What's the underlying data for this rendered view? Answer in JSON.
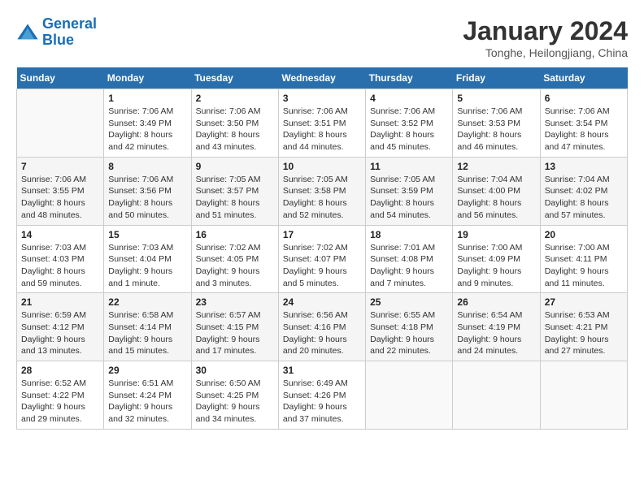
{
  "header": {
    "logo_general": "General",
    "logo_blue": "Blue",
    "month_title": "January 2024",
    "subtitle": "Tonghe, Heilongjiang, China"
  },
  "days_of_week": [
    "Sunday",
    "Monday",
    "Tuesday",
    "Wednesday",
    "Thursday",
    "Friday",
    "Saturday"
  ],
  "weeks": [
    [
      {
        "day": "",
        "sunrise": "",
        "sunset": "",
        "daylight": ""
      },
      {
        "day": "1",
        "sunrise": "Sunrise: 7:06 AM",
        "sunset": "Sunset: 3:49 PM",
        "daylight": "Daylight: 8 hours and 42 minutes."
      },
      {
        "day": "2",
        "sunrise": "Sunrise: 7:06 AM",
        "sunset": "Sunset: 3:50 PM",
        "daylight": "Daylight: 8 hours and 43 minutes."
      },
      {
        "day": "3",
        "sunrise": "Sunrise: 7:06 AM",
        "sunset": "Sunset: 3:51 PM",
        "daylight": "Daylight: 8 hours and 44 minutes."
      },
      {
        "day": "4",
        "sunrise": "Sunrise: 7:06 AM",
        "sunset": "Sunset: 3:52 PM",
        "daylight": "Daylight: 8 hours and 45 minutes."
      },
      {
        "day": "5",
        "sunrise": "Sunrise: 7:06 AM",
        "sunset": "Sunset: 3:53 PM",
        "daylight": "Daylight: 8 hours and 46 minutes."
      },
      {
        "day": "6",
        "sunrise": "Sunrise: 7:06 AM",
        "sunset": "Sunset: 3:54 PM",
        "daylight": "Daylight: 8 hours and 47 minutes."
      }
    ],
    [
      {
        "day": "7",
        "sunrise": "Sunrise: 7:06 AM",
        "sunset": "Sunset: 3:55 PM",
        "daylight": "Daylight: 8 hours and 48 minutes."
      },
      {
        "day": "8",
        "sunrise": "Sunrise: 7:06 AM",
        "sunset": "Sunset: 3:56 PM",
        "daylight": "Daylight: 8 hours and 50 minutes."
      },
      {
        "day": "9",
        "sunrise": "Sunrise: 7:05 AM",
        "sunset": "Sunset: 3:57 PM",
        "daylight": "Daylight: 8 hours and 51 minutes."
      },
      {
        "day": "10",
        "sunrise": "Sunrise: 7:05 AM",
        "sunset": "Sunset: 3:58 PM",
        "daylight": "Daylight: 8 hours and 52 minutes."
      },
      {
        "day": "11",
        "sunrise": "Sunrise: 7:05 AM",
        "sunset": "Sunset: 3:59 PM",
        "daylight": "Daylight: 8 hours and 54 minutes."
      },
      {
        "day": "12",
        "sunrise": "Sunrise: 7:04 AM",
        "sunset": "Sunset: 4:00 PM",
        "daylight": "Daylight: 8 hours and 56 minutes."
      },
      {
        "day": "13",
        "sunrise": "Sunrise: 7:04 AM",
        "sunset": "Sunset: 4:02 PM",
        "daylight": "Daylight: 8 hours and 57 minutes."
      }
    ],
    [
      {
        "day": "14",
        "sunrise": "Sunrise: 7:03 AM",
        "sunset": "Sunset: 4:03 PM",
        "daylight": "Daylight: 8 hours and 59 minutes."
      },
      {
        "day": "15",
        "sunrise": "Sunrise: 7:03 AM",
        "sunset": "Sunset: 4:04 PM",
        "daylight": "Daylight: 9 hours and 1 minute."
      },
      {
        "day": "16",
        "sunrise": "Sunrise: 7:02 AM",
        "sunset": "Sunset: 4:05 PM",
        "daylight": "Daylight: 9 hours and 3 minutes."
      },
      {
        "day": "17",
        "sunrise": "Sunrise: 7:02 AM",
        "sunset": "Sunset: 4:07 PM",
        "daylight": "Daylight: 9 hours and 5 minutes."
      },
      {
        "day": "18",
        "sunrise": "Sunrise: 7:01 AM",
        "sunset": "Sunset: 4:08 PM",
        "daylight": "Daylight: 9 hours and 7 minutes."
      },
      {
        "day": "19",
        "sunrise": "Sunrise: 7:00 AM",
        "sunset": "Sunset: 4:09 PM",
        "daylight": "Daylight: 9 hours and 9 minutes."
      },
      {
        "day": "20",
        "sunrise": "Sunrise: 7:00 AM",
        "sunset": "Sunset: 4:11 PM",
        "daylight": "Daylight: 9 hours and 11 minutes."
      }
    ],
    [
      {
        "day": "21",
        "sunrise": "Sunrise: 6:59 AM",
        "sunset": "Sunset: 4:12 PM",
        "daylight": "Daylight: 9 hours and 13 minutes."
      },
      {
        "day": "22",
        "sunrise": "Sunrise: 6:58 AM",
        "sunset": "Sunset: 4:14 PM",
        "daylight": "Daylight: 9 hours and 15 minutes."
      },
      {
        "day": "23",
        "sunrise": "Sunrise: 6:57 AM",
        "sunset": "Sunset: 4:15 PM",
        "daylight": "Daylight: 9 hours and 17 minutes."
      },
      {
        "day": "24",
        "sunrise": "Sunrise: 6:56 AM",
        "sunset": "Sunset: 4:16 PM",
        "daylight": "Daylight: 9 hours and 20 minutes."
      },
      {
        "day": "25",
        "sunrise": "Sunrise: 6:55 AM",
        "sunset": "Sunset: 4:18 PM",
        "daylight": "Daylight: 9 hours and 22 minutes."
      },
      {
        "day": "26",
        "sunrise": "Sunrise: 6:54 AM",
        "sunset": "Sunset: 4:19 PM",
        "daylight": "Daylight: 9 hours and 24 minutes."
      },
      {
        "day": "27",
        "sunrise": "Sunrise: 6:53 AM",
        "sunset": "Sunset: 4:21 PM",
        "daylight": "Daylight: 9 hours and 27 minutes."
      }
    ],
    [
      {
        "day": "28",
        "sunrise": "Sunrise: 6:52 AM",
        "sunset": "Sunset: 4:22 PM",
        "daylight": "Daylight: 9 hours and 29 minutes."
      },
      {
        "day": "29",
        "sunrise": "Sunrise: 6:51 AM",
        "sunset": "Sunset: 4:24 PM",
        "daylight": "Daylight: 9 hours and 32 minutes."
      },
      {
        "day": "30",
        "sunrise": "Sunrise: 6:50 AM",
        "sunset": "Sunset: 4:25 PM",
        "daylight": "Daylight: 9 hours and 34 minutes."
      },
      {
        "day": "31",
        "sunrise": "Sunrise: 6:49 AM",
        "sunset": "Sunset: 4:26 PM",
        "daylight": "Daylight: 9 hours and 37 minutes."
      },
      {
        "day": "",
        "sunrise": "",
        "sunset": "",
        "daylight": ""
      },
      {
        "day": "",
        "sunrise": "",
        "sunset": "",
        "daylight": ""
      },
      {
        "day": "",
        "sunrise": "",
        "sunset": "",
        "daylight": ""
      }
    ]
  ]
}
